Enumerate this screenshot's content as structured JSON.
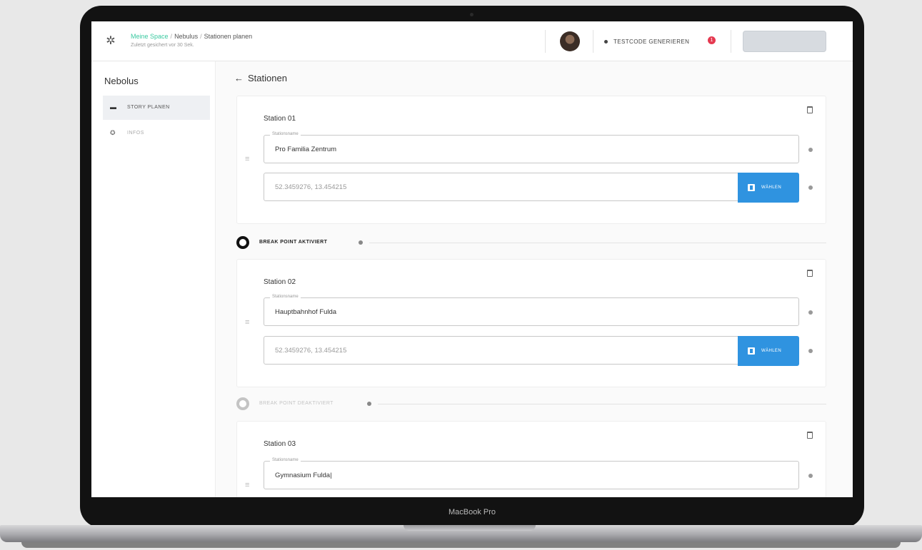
{
  "device_label": "MacBook Pro",
  "header": {
    "breadcrumb": [
      "Meine Space",
      "Nebulus",
      "Stationen planen"
    ],
    "saved_text": "Zuletzt gesichert vor 30 Sek.",
    "testcode_label": "TESTCODE GENERIEREN",
    "notification_count": "1",
    "publish_label": ""
  },
  "sidebar": {
    "title": "Nebolus",
    "items": [
      {
        "label": "STORY PLANEN",
        "icon": "map-icon",
        "active": true
      },
      {
        "label": "INFOS",
        "icon": "gear-icon",
        "active": false
      }
    ]
  },
  "main": {
    "back_label": "Stationen",
    "stations": [
      {
        "title": "Station 01",
        "name_legend": "Stationsname",
        "name_value": "Pro Familia Zentrum",
        "coords_value": "52.3459276, 13.454215",
        "map_button": "WÄHLEN"
      },
      {
        "title": "Station 02",
        "name_legend": "Stationsname",
        "name_value": "Hauptbahnhof Fulda",
        "coords_value": "52.3459276, 13.454215",
        "map_button": "WÄHLEN"
      },
      {
        "title": "Station 03",
        "name_legend": "Stationsname",
        "name_value": "Gymnasium Fulda|"
      }
    ],
    "breakpoints": [
      {
        "label": "BREAK POINT AKTIVIERT",
        "active": true
      },
      {
        "label": "BREAK POINT DEAKTIVIERT",
        "active": false
      }
    ]
  },
  "colors": {
    "accent": "#2f93e0",
    "breadcrumb_home": "#3ac9a0",
    "notification": "#e53950"
  }
}
